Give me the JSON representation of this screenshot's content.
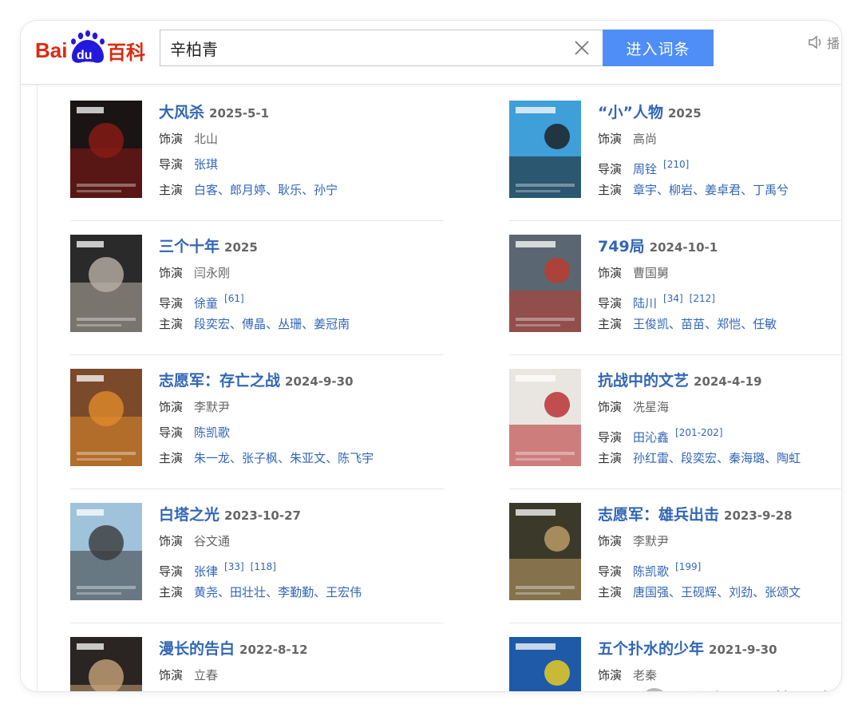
{
  "header": {
    "logo_text": "Baidu百科",
    "search_value": "辛柏青",
    "search_button": "进入词条",
    "read_label": "播"
  },
  "labels": {
    "role": "饰演",
    "director": "导演",
    "cast": "主演"
  },
  "films": [
    {
      "title": "大风杀",
      "date": "2025-5-1",
      "role": "北山",
      "directors": [
        {
          "name": "张琪",
          "refs": []
        }
      ],
      "cast": [
        "白客",
        "郎月婷",
        "耿乐",
        "孙宁"
      ],
      "poster_colors": [
        "#1a1414",
        "#8c1a14"
      ]
    },
    {
      "title": "“小”人物",
      "date": "2025",
      "role": "高尚",
      "directors": [
        {
          "name": "周铨",
          "refs": [
            "[210]"
          ]
        }
      ],
      "cast": [
        "章宇",
        "柳岩",
        "姜卓君",
        "丁禹兮"
      ],
      "poster_colors": [
        "#3f9fd8",
        "#1c1c1c"
      ]
    },
    {
      "title": "三个十年",
      "date": "2025",
      "role": "闫永刚",
      "directors": [
        {
          "name": "徐童",
          "refs": [
            "[61]"
          ]
        }
      ],
      "cast": [
        "段奕宏",
        "傅晶",
        "丛珊",
        "姜冠南"
      ],
      "poster_colors": [
        "#2a2a2a",
        "#b9b0a6"
      ]
    },
    {
      "title": "749局",
      "date": "2024-10-1",
      "role": "曹国舅",
      "directors": [
        {
          "name": "陆川",
          "refs": [
            "[34]",
            "[212]"
          ]
        }
      ],
      "cast": [
        "王俊凯",
        "苗苗",
        "郑恺",
        "任敏"
      ],
      "poster_colors": [
        "#5a6772",
        "#c03a2b"
      ]
    },
    {
      "title": "志愿军：存亡之战",
      "date": "2024-9-30",
      "role": "李默尹",
      "directors": [
        {
          "name": "陈凯歌",
          "refs": []
        }
      ],
      "cast": [
        "朱一龙",
        "张子枫",
        "朱亚文",
        "陈飞宇"
      ],
      "poster_colors": [
        "#7a4a2a",
        "#e08a2a"
      ]
    },
    {
      "title": "抗战中的文艺",
      "date": "2024-4-19",
      "role": "冼星海",
      "directors": [
        {
          "name": "田沁鑫",
          "refs": [
            "[201-202]"
          ]
        }
      ],
      "cast": [
        "孙红雷",
        "段奕宏",
        "秦海璐",
        "陶虹"
      ],
      "poster_colors": [
        "#e9e6e2",
        "#b8272a"
      ]
    },
    {
      "title": "白塔之光",
      "date": "2023-10-27",
      "role": "谷文通",
      "directors": [
        {
          "name": "张律",
          "refs": [
            "[33]",
            "[118]"
          ]
        }
      ],
      "cast": [
        "黄尧",
        "田壮壮",
        "李勤勤",
        "王宏伟"
      ],
      "poster_colors": [
        "#9fc3db",
        "#3a3a3a"
      ]
    },
    {
      "title": "志愿军：雄兵出击",
      "date": "2023-9-28",
      "role": "李默尹",
      "directors": [
        {
          "name": "陈凯歌",
          "refs": [
            "[199]"
          ]
        }
      ],
      "cast": [
        "唐国强",
        "王砚辉",
        "刘劲",
        "张颂文"
      ],
      "poster_colors": [
        "#3b3a2a",
        "#c2a16a"
      ]
    },
    {
      "title": "漫长的告白",
      "date": "2022-8-12",
      "role": "立春",
      "directors": [],
      "cast": [],
      "poster_colors": [
        "#2a2522",
        "#c7a27a"
      ]
    },
    {
      "title": "五个扑水的少年",
      "date": "2021-9-30",
      "role": "老秦",
      "directors": [],
      "cast": [],
      "poster_colors": [
        "#1e5aa8",
        "#f2d21c"
      ]
    }
  ],
  "watermark": {
    "text": "公众号 · 萝严肃"
  },
  "colors": {
    "link": "#3166b6",
    "button": "#4e8ef6",
    "logo_red": "#de2910",
    "logo_blue": "#2319dc"
  }
}
